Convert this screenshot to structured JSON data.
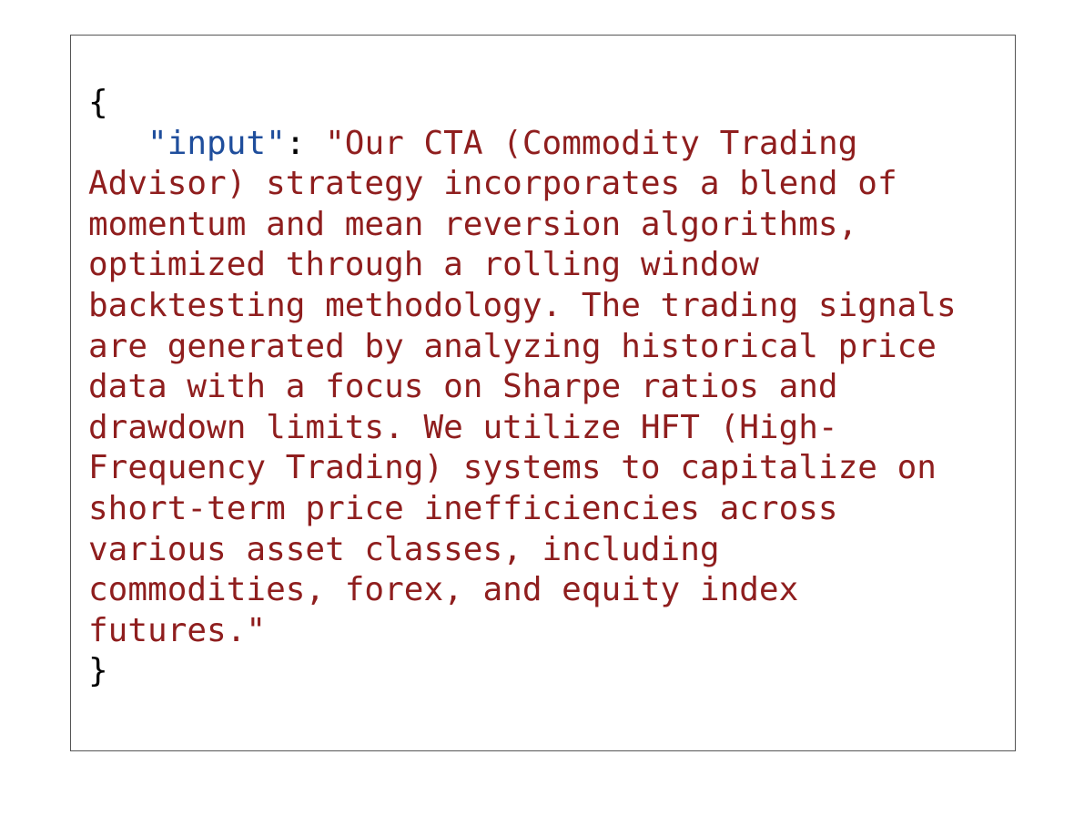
{
  "code": {
    "open_brace": "{",
    "indent": "   ",
    "key": "\"input\"",
    "colon": ": ",
    "value_lines": [
      "\"Our CTA (Commodity Trading",
      "Advisor) strategy incorporates a blend of",
      "momentum and mean reversion algorithms,",
      "optimized through a rolling window",
      "backtesting methodology. The trading signals",
      "are generated by analyzing historical price",
      "data with a focus on Sharpe ratios and",
      "drawdown limits. We utilize HFT (High-",
      "Frequency Trading) systems to capitalize on",
      "short-term price inefficiencies across",
      "various asset classes, including",
      "commodities, forex, and equity index",
      "futures.\""
    ],
    "close_brace": "}"
  },
  "colors": {
    "key": "#1f4e9c",
    "string": "#8f1e1e",
    "punctuation": "#000000",
    "border": "#555555",
    "background": "#ffffff"
  }
}
